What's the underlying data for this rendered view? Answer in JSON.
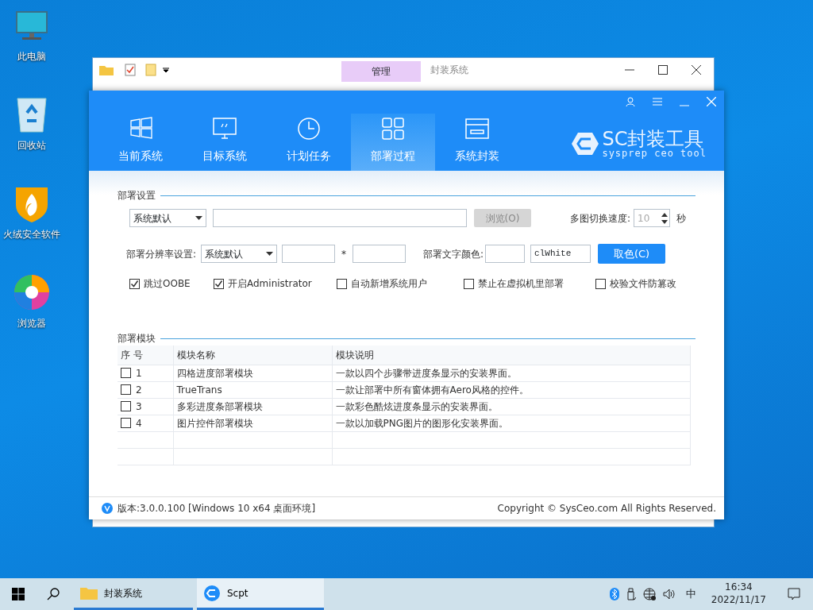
{
  "desktop_icons": [
    {
      "kind": "computer",
      "label": "此电脑"
    },
    {
      "kind": "recycle",
      "label": "回收站"
    },
    {
      "kind": "shield",
      "label": "火绒安全软件"
    },
    {
      "kind": "browser",
      "label": "浏览器"
    }
  ],
  "explorer": {
    "context_tab": "管理",
    "title": "封装系统"
  },
  "app": {
    "tabs": [
      {
        "kind": "windows",
        "label": "当前系统",
        "selected": false
      },
      {
        "kind": "monitor",
        "label": "目标系统",
        "selected": false
      },
      {
        "kind": "clock",
        "label": "计划任务",
        "selected": false
      },
      {
        "kind": "grid",
        "label": "部署过程",
        "selected": true
      },
      {
        "kind": "box",
        "label": "系统封装",
        "selected": false
      }
    ],
    "logo": {
      "title": "SC封装工具",
      "subtitle": "sysprep ceo tool"
    },
    "deploy_settings": {
      "heading": "部署设置",
      "mode": "系统默认",
      "browse": {
        "label": "浏览(O)",
        "disabled": true
      },
      "speed_label": "多图切换速度:",
      "speed": {
        "value": "10",
        "disabled": true
      },
      "speed_unit": "秒",
      "resolution_label": "部署分辨率设置:",
      "resolution_mode": "系统默认",
      "times": "*",
      "color_label": "部署文字颜色:",
      "color_value": "clWhite",
      "pick_button": "取色(C)"
    },
    "options": [
      {
        "label": "跳过OOBE",
        "checked": true
      },
      {
        "label": "开启Administrator",
        "checked": true
      },
      {
        "label": "自动新增系统用户",
        "checked": false
      },
      {
        "label": "禁止在虚拟机里部署",
        "checked": false
      },
      {
        "label": "校验文件防篡改",
        "checked": false
      }
    ],
    "modules": {
      "heading": "部署模块",
      "columns": [
        "序 号",
        "模块名称",
        "模块说明"
      ],
      "rows": [
        {
          "index": "1",
          "name": "四格进度部署模块",
          "desc": "一款以四个步骤带进度条显示的安装界面。",
          "checked": false
        },
        {
          "index": "2",
          "name": "TrueTrans",
          "desc": "一款让部署中所有窗体拥有Aero风格的控件。",
          "checked": false
        },
        {
          "index": "3",
          "name": "多彩进度条部署模块",
          "desc": "一款彩色酷炫进度条显示的安装界面。",
          "checked": false
        },
        {
          "index": "4",
          "name": "图片控件部署模块",
          "desc": "一款以加载PNG图片的图形化安装界面。",
          "checked": false
        }
      ]
    },
    "status": {
      "version": "版本:3.0.0.100 [Windows 10 x64 桌面环境]",
      "copyright": "Copyright © SysCeo.com All Rights Reserved."
    }
  },
  "taskbar": {
    "items": [
      {
        "kind": "folder",
        "label": "封装系统",
        "selected": false
      },
      {
        "kind": "app",
        "label": "Scpt",
        "selected": true
      }
    ],
    "ime": "中",
    "time": "16:34",
    "date": "2022/11/17"
  }
}
